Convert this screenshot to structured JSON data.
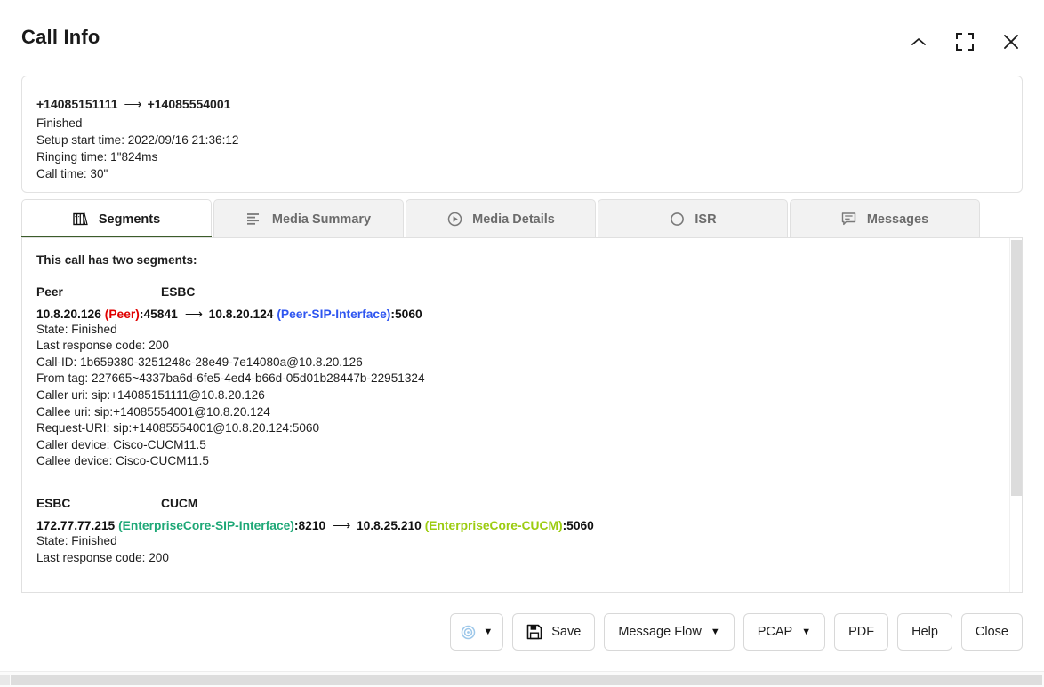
{
  "window": {
    "title": "Call Info",
    "actions": [
      {
        "name": "collapse",
        "icon": "chevron-up-icon"
      },
      {
        "name": "fullscreen",
        "icon": "expand-icon"
      },
      {
        "name": "close",
        "icon": "close-icon"
      }
    ]
  },
  "summary": {
    "caller": "+14085151111",
    "arrow": "⟶",
    "callee": "+14085554001",
    "state": "Finished",
    "setup_start_time": "Setup start time: 2022/09/16 21:36:12",
    "ringing_time": "Ringing time: 1\"824ms",
    "call_time": "Call time: 30\""
  },
  "tabs": [
    {
      "label": "Segments",
      "icon": "segments-icon",
      "active": true
    },
    {
      "label": "Media Summary",
      "icon": "list-lines-icon",
      "active": false
    },
    {
      "label": "Media Details",
      "icon": "play-circle-icon",
      "active": false
    },
    {
      "label": "ISR",
      "icon": "circle-icon",
      "active": false
    },
    {
      "label": "Messages",
      "icon": "speech-bubble-icon",
      "active": false
    }
  ],
  "content": {
    "intro": "This call has two segments:",
    "segments": [
      {
        "left_host": "Peer",
        "right_host": "ESBC",
        "route": {
          "src_ip": "10.8.20.126",
          "src_label": "(Peer)",
          "src_label_color": "#e00000",
          "src_port": ":45841",
          "arrow": "⟶",
          "dst_ip": "10.8.20.124",
          "dst_label": "(Peer-SIP-Interface)",
          "dst_label_color": "#2f56f0",
          "dst_port": ":5060"
        },
        "details": [
          "State: Finished",
          "Last response code: 200",
          "Call-ID: 1b659380-3251248c-28e49-7e14080a@10.8.20.126",
          "From tag: 227665~4337ba6d-6fe5-4ed4-b66d-05d01b28447b-22951324",
          "Caller uri: sip:+14085151111@10.8.20.126",
          "Callee uri: sip:+14085554001@10.8.20.124",
          "Request-URI: sip:+14085554001@10.8.20.124:5060",
          "Caller device: Cisco-CUCM11.5",
          "Callee device: Cisco-CUCM11.5"
        ]
      },
      {
        "left_host": "ESBC",
        "right_host": "CUCM",
        "route": {
          "src_ip": "172.77.77.215",
          "src_label": "(EnterpriseCore-SIP-Interface)",
          "src_label_color": "#1fa877",
          "src_port": ":8210",
          "arrow": "⟶",
          "dst_ip": "10.8.25.210",
          "dst_label": "(EnterpriseCore-CUCM)",
          "dst_label_color": "#9ccc10",
          "dst_port": ":5060"
        },
        "details": [
          "State: Finished",
          "Last response code: 200"
        ]
      }
    ]
  },
  "toolbar": {
    "record_button": {
      "label": "",
      "icon": "target-circle-icon",
      "caret": "▼"
    },
    "save_label": "Save",
    "save_icon": "floppy-disk-icon",
    "message_flow_label": "Message Flow",
    "message_flow_caret": "▼",
    "pcap_label": "PCAP",
    "pcap_caret": "▼",
    "pdf_label": "PDF",
    "help_label": "Help",
    "close_label": "Close"
  }
}
